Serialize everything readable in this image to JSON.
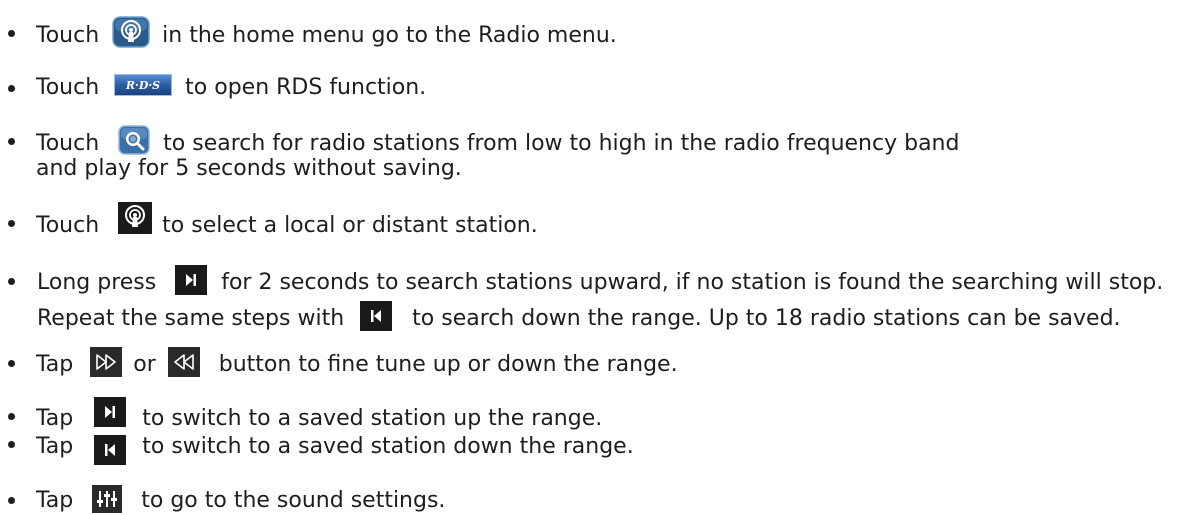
{
  "items": [
    {
      "lines": [
        {
          "before": "Touch",
          "after": "in the home menu go to the Radio menu."
        }
      ],
      "icon": "radio-home-icon"
    },
    {
      "lines": [
        {
          "before": "Touch",
          "after": "to open RDS function."
        }
      ],
      "icon": "rds-button-icon",
      "icon_text": "R·D·S"
    },
    {
      "lines": [
        {
          "before": "Touch",
          "after": "to search for radio stations from low to high in the radio frequency band"
        },
        {
          "text": "and play for 5 seconds without saving."
        }
      ],
      "icon": "search-scan-icon"
    },
    {
      "lines": [
        {
          "before": "Touch",
          "after": "to select a local or distant station."
        }
      ],
      "icon": "local-distant-icon"
    },
    {
      "lines": [
        {
          "before": "Long press",
          "after": "for 2 seconds to search stations upward, if no station is found the searching will stop."
        },
        {
          "before": "Repeat the same steps with",
          "after": "to search down the range. Up to 18 radio stations can be saved."
        }
      ],
      "icons": [
        "next-station-icon",
        "previous-station-icon"
      ]
    },
    {
      "lines": [
        {
          "before": "Tap",
          "middle": "or",
          "after": "button to fine tune up or down the range."
        }
      ],
      "icons": [
        "fast-forward-icon",
        "rewind-icon"
      ]
    },
    {
      "lines": [
        {
          "before": "Tap",
          "after": "to switch to a saved station up the range."
        }
      ],
      "icon": "next-station-icon"
    },
    {
      "lines": [
        {
          "before": "Tap",
          "after": "to switch to a saved station down the range."
        }
      ],
      "icon": "previous-station-icon"
    },
    {
      "lines": [
        {
          "before": "Tap",
          "after": "to go to the sound settings."
        }
      ],
      "icon": "equalizer-icon"
    }
  ],
  "colors": {
    "text": "#1e1e1e",
    "icon_dark": "#1a1a1a",
    "radio_icon_bg": "#2a5a8a",
    "rds_bg": "#2b5ea8",
    "search_bg": "#3a6fa8"
  }
}
